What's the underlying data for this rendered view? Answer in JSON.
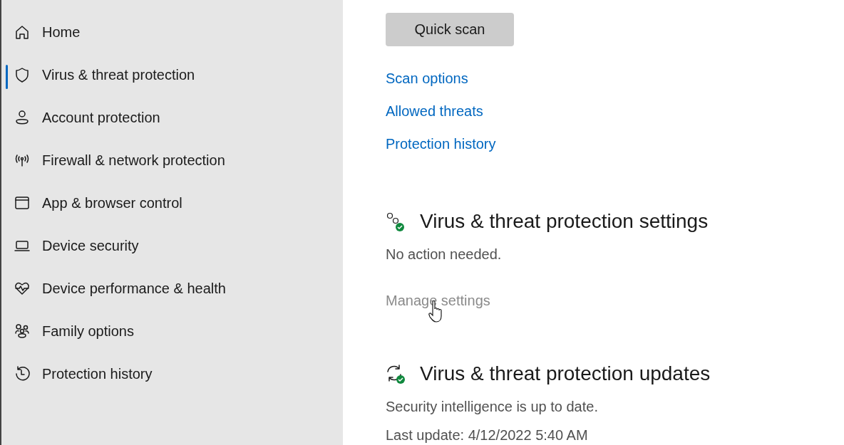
{
  "sidebar": {
    "items": [
      {
        "label": "Home",
        "selected": false
      },
      {
        "label": "Virus & threat protection",
        "selected": true
      },
      {
        "label": "Account protection",
        "selected": false
      },
      {
        "label": "Firewall & network protection",
        "selected": false
      },
      {
        "label": "App & browser control",
        "selected": false
      },
      {
        "label": "Device security",
        "selected": false
      },
      {
        "label": "Device performance & health",
        "selected": false
      },
      {
        "label": "Family options",
        "selected": false
      },
      {
        "label": "Protection history",
        "selected": false
      }
    ]
  },
  "main": {
    "quick_scan_button": "Quick scan",
    "links": [
      "Scan options",
      "Allowed threats",
      "Protection history"
    ],
    "sections": [
      {
        "title": "Virus & threat protection settings",
        "lines": [
          "No action needed."
        ],
        "link": {
          "label": "Manage settings",
          "disabled": true
        }
      },
      {
        "title": "Virus & threat protection updates",
        "lines": [
          "Security intelligence is up to date.",
          "Last update: 4/12/2022 5:40 AM"
        ]
      }
    ]
  }
}
